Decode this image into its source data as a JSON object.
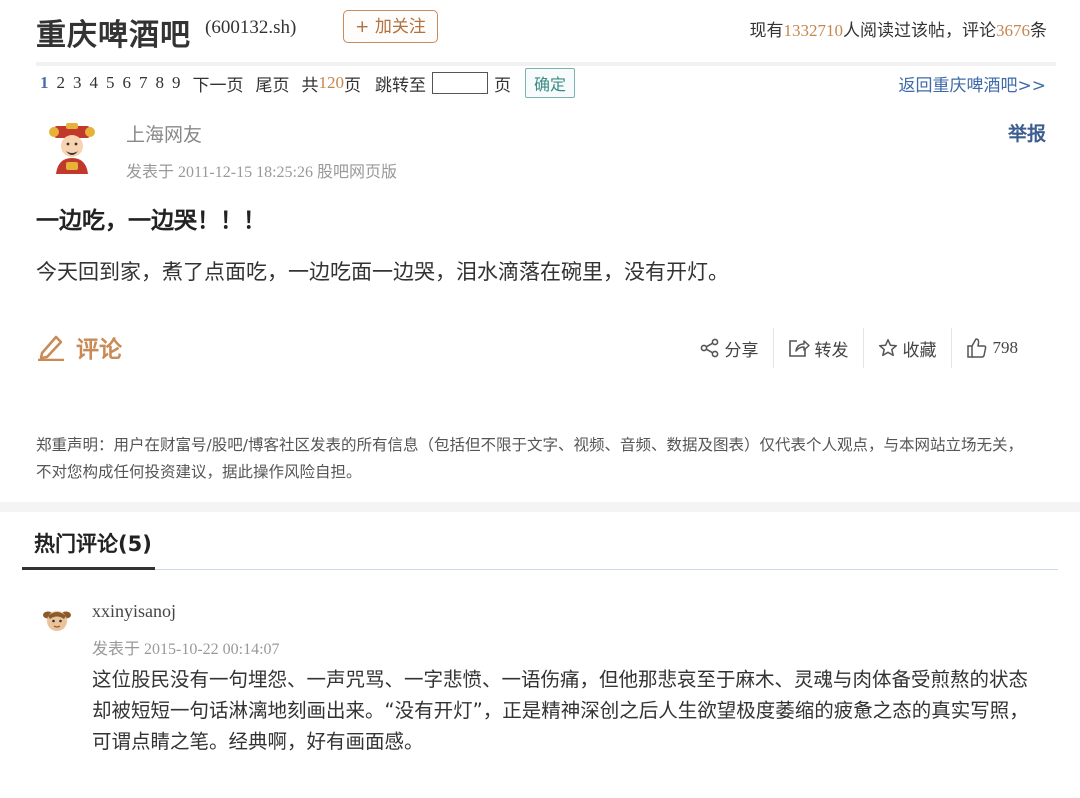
{
  "header": {
    "bar_title": "重庆啤酒吧",
    "stock_code": "(600132.sh)",
    "follow_label": "+ 加关注",
    "stats_prefix": "现有",
    "readers": "1332710",
    "stats_mid": "人阅读过该帖，评论",
    "comments": "3676",
    "stats_suffix": "条"
  },
  "pager": {
    "pages": [
      "1",
      "2",
      "3",
      "4",
      "5",
      "6",
      "7",
      "8",
      "9"
    ],
    "next": "下一页",
    "last": "尾页",
    "total_prefix": "共",
    "total": "120",
    "total_suffix": "页",
    "jump_label": "跳转至",
    "jump_unit": "页",
    "confirm": "确定",
    "back_link": "返回重庆啤酒吧>>"
  },
  "post": {
    "author": "上海网友",
    "meta": "发表于 2011-12-15 18:25:26 股吧网页版",
    "report": "举报",
    "title": "一边吃，一边哭！！！",
    "body": "今天回到家，煮了点面吃，一边吃面一边哭，泪水滴落在碗里，没有开灯。"
  },
  "actions": {
    "comment": "评论",
    "share": "分享",
    "forward": "转发",
    "favorite": "收藏",
    "likes": "798"
  },
  "disclaimer": "郑重声明：用户在财富号/股吧/博客社区发表的所有信息（包括但不限于文字、视频、音频、数据及图表）仅代表个人观点，与本网站立场无关，不对您构成任何投资建议，据此操作风险自担。",
  "hot": {
    "title": "热门评论(5)",
    "comment": {
      "user": "xxinyisanoj",
      "meta": "发表于 2015-10-22 00:14:07",
      "body": "这位股民没有一句埋怨、一声咒骂、一字悲愤、一语伤痛，但他那悲哀至于麻木、灵魂与肉体备受煎熬的状态却被短短一句话淋漓地刻画出来。“没有开灯”，正是精神深创之后人生欲望极度萎缩的疲惫之态的真实写照，可谓点睛之笔。经典啊，好有画面感。"
    }
  },
  "colors": {
    "accent_orange": "#c4874f",
    "link_blue": "#3e6aa8"
  }
}
